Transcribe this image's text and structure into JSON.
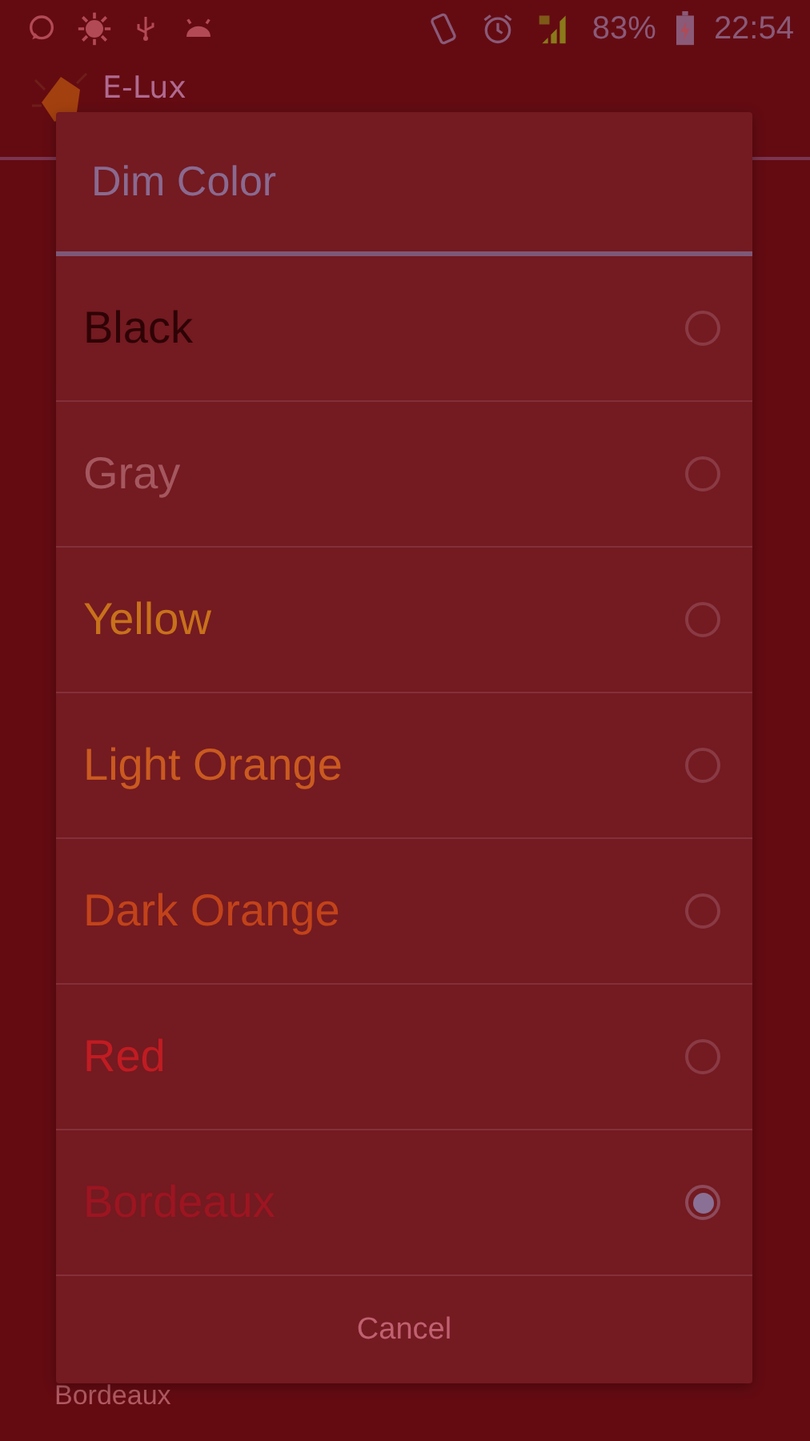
{
  "status_bar": {
    "battery": "83%",
    "time": "22:54"
  },
  "app_bar": {
    "title": "E-Lux"
  },
  "dialog": {
    "title": "Dim Color",
    "options": [
      {
        "label": "Black",
        "color": "#2e0306",
        "selected": false
      },
      {
        "label": "Gray",
        "color": "#a5575f",
        "selected": false
      },
      {
        "label": "Yellow",
        "color": "#c8711c",
        "selected": false
      },
      {
        "label": "Light Orange",
        "color": "#c95a20",
        "selected": false
      },
      {
        "label": "Dark Orange",
        "color": "#c2431a",
        "selected": false
      },
      {
        "label": "Red",
        "color": "#c01c22",
        "selected": false
      },
      {
        "label": "Bordeaux",
        "color": "#9c1521",
        "selected": true
      }
    ],
    "cancel": "Cancel"
  },
  "background_summary": "Bordeaux"
}
